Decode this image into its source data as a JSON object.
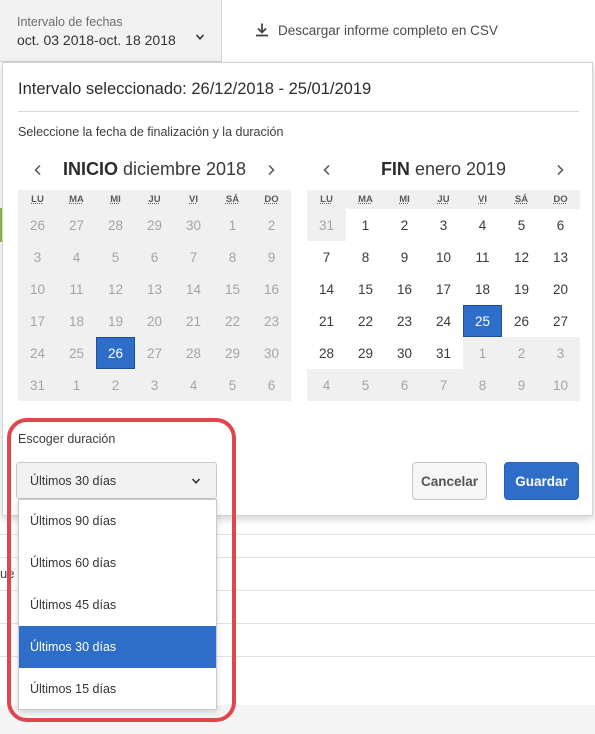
{
  "topbar": {
    "range_label": "Intervalo de fechas",
    "range_value": "oct. 03 2018-oct. 18 2018",
    "csv_label": "Descargar informe completo en CSV"
  },
  "background": {
    "partial_text": "ue"
  },
  "popover": {
    "title": "Intervalo seleccionado: 26/12/2018 - 25/01/2019",
    "instructions": "Seleccione la fecha de finalización y la duración",
    "weekdays": [
      "LU",
      "MA",
      "MI",
      "JU",
      "VI",
      "SÁ",
      "DO"
    ],
    "start_calendar": {
      "label": "INICIO",
      "month": "diciembre 2018",
      "days": [
        {
          "d": "26",
          "cur": false
        },
        {
          "d": "27",
          "cur": false
        },
        {
          "d": "28",
          "cur": false
        },
        {
          "d": "29",
          "cur": false
        },
        {
          "d": "30",
          "cur": false
        },
        {
          "d": "1",
          "cur": false
        },
        {
          "d": "2",
          "cur": false
        },
        {
          "d": "3",
          "cur": false
        },
        {
          "d": "4",
          "cur": false
        },
        {
          "d": "5",
          "cur": false
        },
        {
          "d": "6",
          "cur": false
        },
        {
          "d": "7",
          "cur": false
        },
        {
          "d": "8",
          "cur": false
        },
        {
          "d": "9",
          "cur": false
        },
        {
          "d": "10",
          "cur": false
        },
        {
          "d": "11",
          "cur": false
        },
        {
          "d": "12",
          "cur": false
        },
        {
          "d": "13",
          "cur": false
        },
        {
          "d": "14",
          "cur": false
        },
        {
          "d": "15",
          "cur": false
        },
        {
          "d": "16",
          "cur": false
        },
        {
          "d": "17",
          "cur": false
        },
        {
          "d": "18",
          "cur": false
        },
        {
          "d": "19",
          "cur": false
        },
        {
          "d": "20",
          "cur": false
        },
        {
          "d": "21",
          "cur": false
        },
        {
          "d": "22",
          "cur": false
        },
        {
          "d": "23",
          "cur": false
        },
        {
          "d": "24",
          "cur": false
        },
        {
          "d": "25",
          "cur": false
        },
        {
          "d": "26",
          "cur": false,
          "sel": true
        },
        {
          "d": "27",
          "cur": false
        },
        {
          "d": "28",
          "cur": false
        },
        {
          "d": "29",
          "cur": false
        },
        {
          "d": "30",
          "cur": false
        },
        {
          "d": "31",
          "cur": false
        },
        {
          "d": "1",
          "cur": false
        },
        {
          "d": "2",
          "cur": false
        },
        {
          "d": "3",
          "cur": false
        },
        {
          "d": "4",
          "cur": false
        },
        {
          "d": "5",
          "cur": false
        },
        {
          "d": "6",
          "cur": false
        }
      ]
    },
    "end_calendar": {
      "label": "FIN",
      "month": "enero 2019",
      "days": [
        {
          "d": "31",
          "cur": false
        },
        {
          "d": "1",
          "cur": true
        },
        {
          "d": "2",
          "cur": true
        },
        {
          "d": "3",
          "cur": true
        },
        {
          "d": "4",
          "cur": true
        },
        {
          "d": "5",
          "cur": true
        },
        {
          "d": "6",
          "cur": true
        },
        {
          "d": "7",
          "cur": true
        },
        {
          "d": "8",
          "cur": true
        },
        {
          "d": "9",
          "cur": true
        },
        {
          "d": "10",
          "cur": true
        },
        {
          "d": "11",
          "cur": true
        },
        {
          "d": "12",
          "cur": true
        },
        {
          "d": "13",
          "cur": true
        },
        {
          "d": "14",
          "cur": true
        },
        {
          "d": "15",
          "cur": true
        },
        {
          "d": "16",
          "cur": true
        },
        {
          "d": "17",
          "cur": true
        },
        {
          "d": "18",
          "cur": true
        },
        {
          "d": "19",
          "cur": true
        },
        {
          "d": "20",
          "cur": true
        },
        {
          "d": "21",
          "cur": true
        },
        {
          "d": "22",
          "cur": true
        },
        {
          "d": "23",
          "cur": true
        },
        {
          "d": "24",
          "cur": true
        },
        {
          "d": "25",
          "cur": true,
          "sel": true
        },
        {
          "d": "26",
          "cur": true
        },
        {
          "d": "27",
          "cur": true
        },
        {
          "d": "28",
          "cur": true
        },
        {
          "d": "29",
          "cur": true
        },
        {
          "d": "30",
          "cur": true
        },
        {
          "d": "31",
          "cur": true
        },
        {
          "d": "1",
          "cur": false
        },
        {
          "d": "2",
          "cur": false
        },
        {
          "d": "3",
          "cur": false
        },
        {
          "d": "4",
          "cur": false
        },
        {
          "d": "5",
          "cur": false
        },
        {
          "d": "6",
          "cur": false
        },
        {
          "d": "7",
          "cur": false
        },
        {
          "d": "8",
          "cur": false
        },
        {
          "d": "9",
          "cur": false
        },
        {
          "d": "10",
          "cur": false
        }
      ]
    },
    "duration_label": "Escoger duración",
    "duration_value": "Últimos 30 días",
    "duration_options": [
      {
        "label": "Últimos 90 días",
        "active": false
      },
      {
        "label": "Últimos 60 días",
        "active": false
      },
      {
        "label": "Últimos 45 días",
        "active": false
      },
      {
        "label": "Últimos 30 días",
        "active": true
      },
      {
        "label": "Últimos 15 días",
        "active": false
      }
    ],
    "cancel_label": "Cancelar",
    "save_label": "Guardar"
  },
  "icons": {
    "range_chevron": "chevron-down-icon",
    "csv": "download-icon",
    "prev": "chevron-left-icon",
    "next": "chevron-right-icon",
    "duration_chevron": "chevron-down-icon"
  },
  "colors": {
    "accent": "#2e6ec9",
    "highlight": "#e0474c",
    "range_bg": "#f2f2f2",
    "calendar_bg": "#f0f0f0"
  }
}
